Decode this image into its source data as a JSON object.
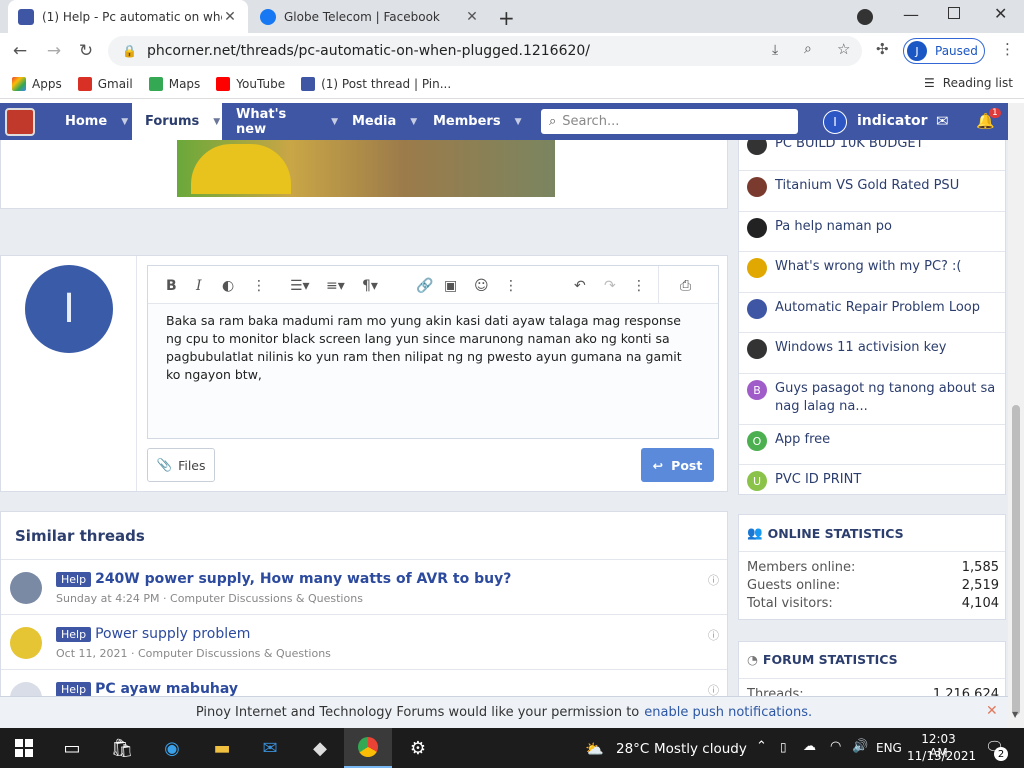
{
  "browser": {
    "tabs": [
      {
        "title": "(1) Help - Pc automatic on when plugged"
      },
      {
        "title": "Globe Telecom | Facebook"
      }
    ],
    "url": "phcorner.net/threads/pc-automatic-on-when-plugged.1216620/",
    "profile_label": "Paused",
    "profile_initial": "J",
    "bookmarks": [
      {
        "label": "Apps",
        "color": "#ea4335"
      },
      {
        "label": "Gmail",
        "color": "#d93025"
      },
      {
        "label": "Maps",
        "color": "#34a853"
      },
      {
        "label": "YouTube",
        "color": "#ff0000"
      },
      {
        "label": "(1) Post thread | Pin...",
        "color": "#3f56a4"
      }
    ],
    "reading_list": "Reading list"
  },
  "site": {
    "nav": [
      "Home",
      "Forums",
      "What's new",
      "Media",
      "Members"
    ],
    "search_placeholder": "Search...",
    "username": "indicator",
    "user_initial": "I",
    "alert_count": "1"
  },
  "editor": {
    "avatar_initial": "I",
    "text": "Baka sa ram baka madumi ram mo yung akin kasi dati ayaw talaga mag response ng cpu to monitor black screen lang yun since marunong naman ako ng konti sa pagbubulatlat nilinis ko yun ram then nilipat ng ng pwesto ayun gumana na gamit ko ngayon btw,",
    "files_label": "Files",
    "post_label": "Post"
  },
  "similar": {
    "heading": "Similar threads",
    "threads": [
      {
        "badge": "Help",
        "title": "240W power supply, How many watts of AVR to buy?",
        "meta": "Sunday at 4:24 PM · Computer Discussions & Questions"
      },
      {
        "badge": "Help",
        "title": "Power supply problem",
        "meta": "Oct 11, 2021 · Computer Discussions & Questions"
      },
      {
        "badge": "Help",
        "title": "PC ayaw mabuhay",
        "meta": ""
      }
    ]
  },
  "sidebar": {
    "threads": [
      {
        "title": "PC BUILD 10K BUDGET",
        "color": "#333",
        "initial": ""
      },
      {
        "title": "Titanium VS Gold Rated PSU",
        "color": "#7a3b2e",
        "initial": ""
      },
      {
        "title": "Pa help naman po",
        "color": "#222",
        "initial": ""
      },
      {
        "title": "What's wrong with my PC? :(",
        "color": "#e0a800",
        "initial": ""
      },
      {
        "title": "Automatic Repair Problem Loop",
        "color": "#3f56a4",
        "initial": ""
      },
      {
        "title": "Windows 11 activision key",
        "color": "#333",
        "initial": ""
      },
      {
        "title": "Guys pasagot ng tanong about sa nag lalag na...",
        "color": "#a05cc8",
        "initial": "B"
      },
      {
        "title": "App free",
        "color": "#4caf50",
        "initial": "O"
      },
      {
        "title": "PVC ID PRINT",
        "color": "#8bc34a",
        "initial": "U"
      }
    ],
    "online_heading": "ONLINE STATISTICS",
    "online": [
      {
        "label": "Members online:",
        "value": "1,585"
      },
      {
        "label": "Guests online:",
        "value": "2,519"
      },
      {
        "label": "Total visitors:",
        "value": "4,104"
      }
    ],
    "forum_heading": "FORUM STATISTICS",
    "forum": [
      {
        "label": "Threads:",
        "value": "1,216,624"
      }
    ]
  },
  "notice": {
    "text": "Pinoy Internet and Technology Forums would like your permission to",
    "link": "enable push notifications."
  },
  "taskbar": {
    "temp": "28°C",
    "weather": "Mostly cloudy",
    "lang": "ENG",
    "time": "12:03 AM",
    "date": "11/13/2021",
    "notif_count": "2"
  }
}
